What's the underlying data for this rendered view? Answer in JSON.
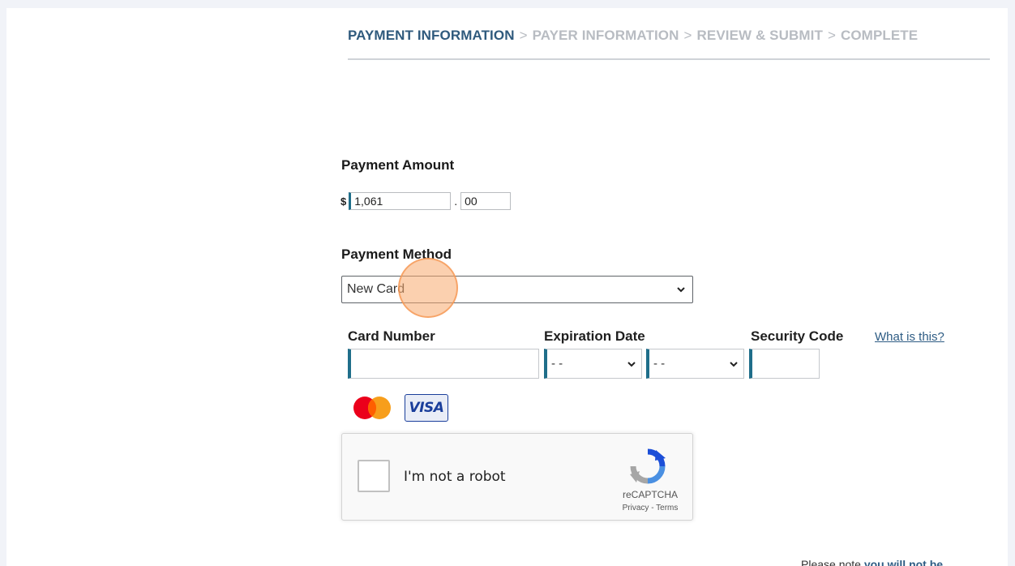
{
  "breadcrumb": {
    "steps": [
      "PAYMENT INFORMATION",
      "PAYER INFORMATION",
      "REVIEW & SUBMIT",
      "COMPLETE"
    ],
    "separator": ">",
    "active_index": 0
  },
  "payment_amount": {
    "heading": "Payment Amount",
    "currency_symbol": "$",
    "whole_value": "1,061",
    "decimal_separator": ".",
    "cents_value": "00"
  },
  "payment_method": {
    "heading": "Payment Method",
    "selected": "New Card"
  },
  "card": {
    "number_label": "Card Number",
    "number_value": "",
    "expiration_label": "Expiration Date",
    "exp_month_value": "- -",
    "exp_year_value": "- -",
    "security_label": "Security Code",
    "security_value": "",
    "what_is_this": "What is this?",
    "accepted": [
      "mastercard-icon",
      "visa-icon"
    ],
    "visa_text": "VISA"
  },
  "captcha": {
    "label": "I'm not a robot",
    "brand": "reCAPTCHA",
    "privacy": "Privacy",
    "links_separator": " - ",
    "terms": "Terms"
  },
  "note": {
    "prefix": "Please note ",
    "emphasis": "you will not be"
  },
  "colors": {
    "accent": "#2f5a7d",
    "field_accent": "#1f6e8a",
    "inactive_step": "#b8bcc2",
    "highlight": "#f8aa6e"
  }
}
